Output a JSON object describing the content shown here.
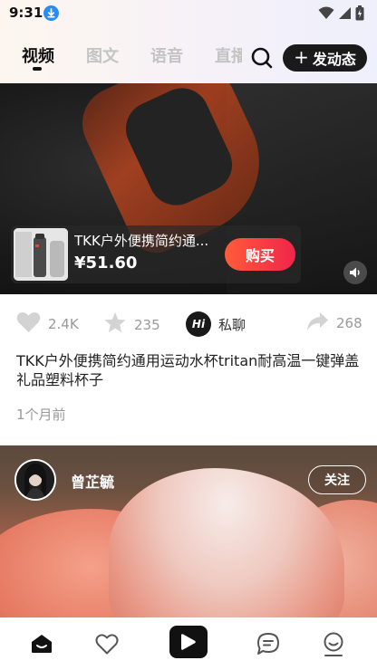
{
  "status_bar": {
    "time": "9:31",
    "icons": [
      "download-icon",
      "wifi-icon",
      "signal-icon",
      "battery-icon"
    ]
  },
  "header": {
    "tabs": [
      {
        "label": "视频",
        "active": true
      },
      {
        "label": "图文",
        "active": false
      },
      {
        "label": "语音",
        "active": false
      },
      {
        "label": "直播",
        "active": false
      }
    ],
    "search_icon": "search-icon",
    "post_button": "发动态",
    "post_button_icon": "plus-icon"
  },
  "feed": {
    "post1": {
      "product": {
        "title": "TKK户外便携简约通...",
        "price": "¥51.60",
        "buy_label": "购买"
      },
      "volume_icon": "volume-icon",
      "actions": {
        "likes": "2.4K",
        "stars": "235",
        "chat_badge": "Hi",
        "chat_label": "私聊",
        "shares": "268"
      },
      "description": "TKK户外便携简约通用运动水杯tritan耐高温一键弹盖礼品塑料杯子",
      "time": "1个月前"
    },
    "post2": {
      "username": "曾芷毓",
      "follow_label": "关注"
    }
  },
  "bottom_nav": {
    "items": [
      "home-icon",
      "heart-icon",
      "video-play-icon",
      "message-icon",
      "profile-icon"
    ],
    "active": "home-icon"
  },
  "colors": {
    "buy_gradient_start": "#ff5b3a",
    "buy_gradient_end": "#f0254a",
    "dark": "#1a1a1a",
    "muted": "#999999"
  }
}
